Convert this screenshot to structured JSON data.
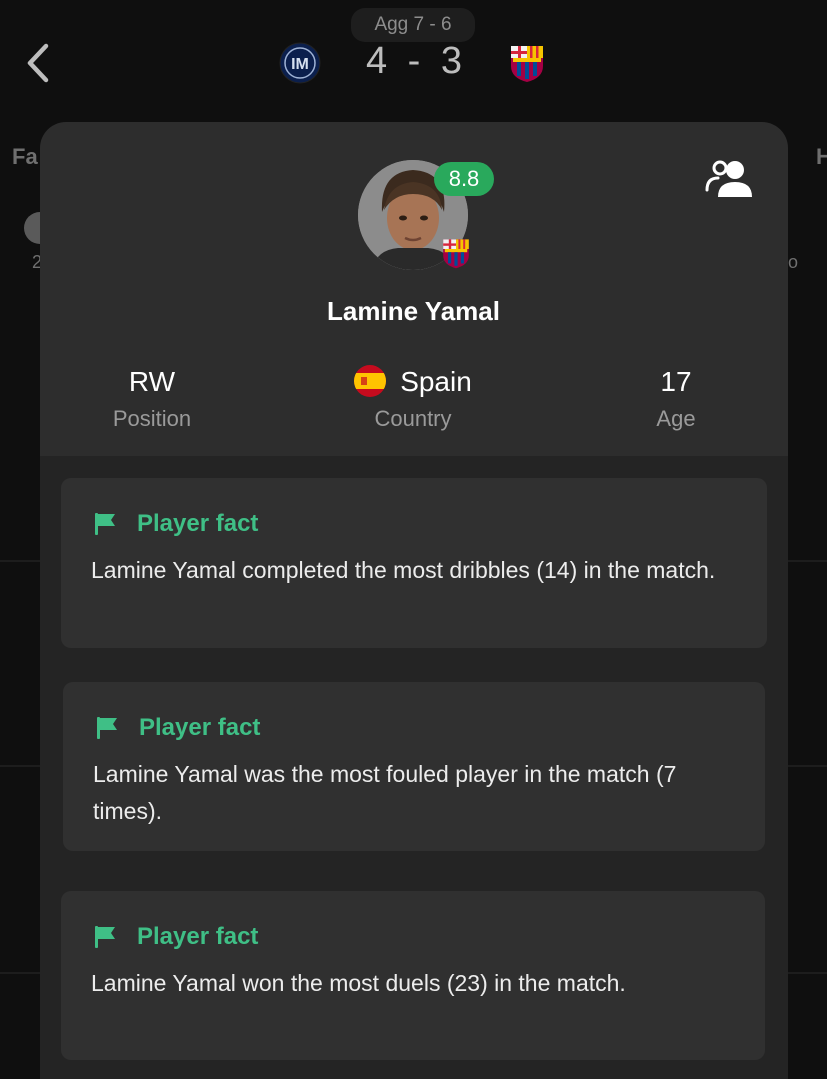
{
  "header": {
    "aggregate": "Agg 7 - 6",
    "score": "4 - 3",
    "home_team_logo": "inter-logo",
    "away_team_logo": "barcelona-logo",
    "back_icon": "chevron-left-icon"
  },
  "background": {
    "left_tab_fragment": "Fa",
    "right_tab_fragment": "H",
    "left_fragment_small": "2",
    "right_fragment_small": "o"
  },
  "player": {
    "name": "Lamine Yamal",
    "rating": "8.8",
    "rating_color": "#29a95c",
    "club_badge": "barcelona-logo",
    "stats": [
      {
        "value": "RW",
        "label": "Position"
      },
      {
        "value": "Spain",
        "label": "Country",
        "flag": "spain-flag"
      },
      {
        "value": "17",
        "label": "Age"
      }
    ],
    "players_icon": "players-icon"
  },
  "facts": [
    {
      "title": "Player fact",
      "text": "Lamine Yamal completed the most dribbles (14) in the match."
    },
    {
      "title": "Player fact",
      "text": "Lamine Yamal was the most fouled player in the match (7 times)."
    },
    {
      "title": "Player fact",
      "text": "Lamine Yamal won the most duels (23) in the match."
    }
  ],
  "colors": {
    "accent": "#3fbf86",
    "background": "#0f0f0f",
    "card": "#2d2d2d",
    "fact_card": "#303030"
  }
}
